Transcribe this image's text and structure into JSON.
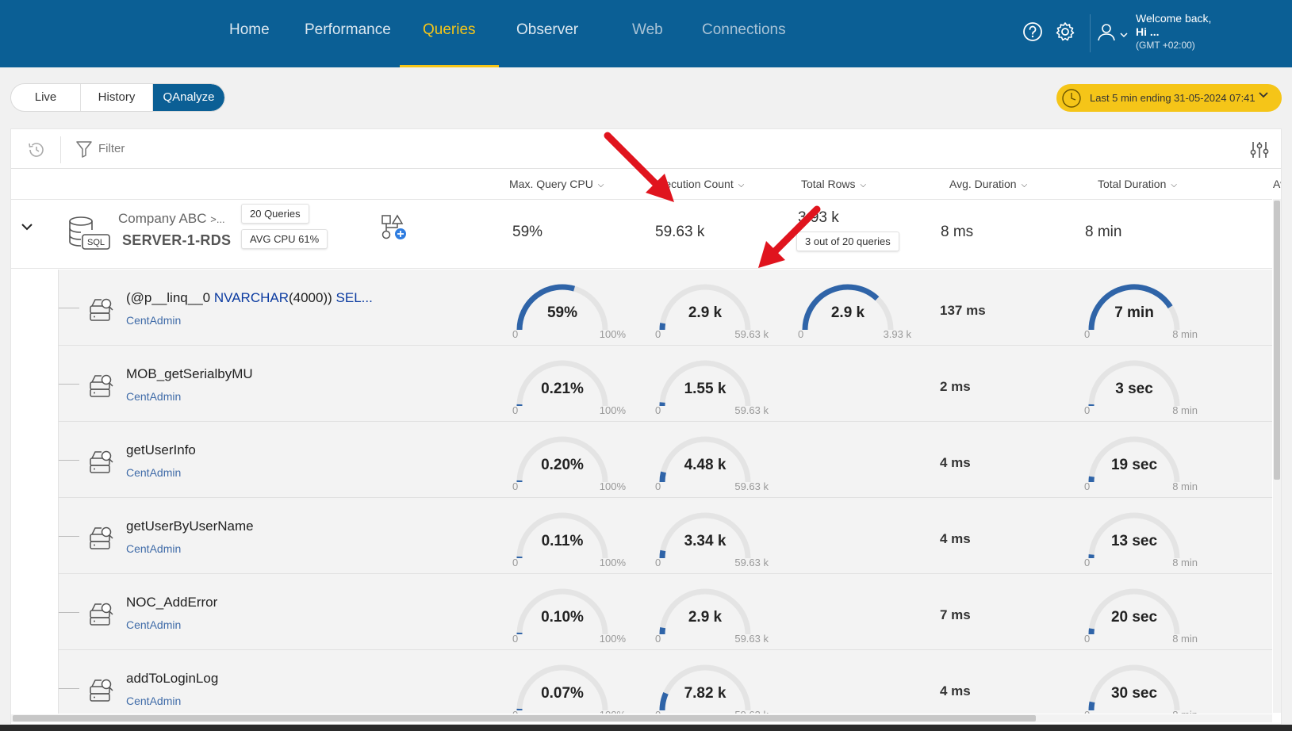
{
  "nav": {
    "items": [
      "Home",
      "Performance",
      "Queries",
      "Observer",
      "Web",
      "Connections"
    ],
    "active": "Queries"
  },
  "user": {
    "welcome": "Welcome back,",
    "name": "Hi  ...",
    "timezone": "(GMT +02:00)"
  },
  "tabs": [
    "Live",
    "History",
    "QAnalyze"
  ],
  "active_tab": "QAnalyze",
  "time_range": {
    "label": "Last 5 min ending",
    "datetime": "31-05-2024 07:41"
  },
  "toolbar": {
    "filter_placeholder": "Filter"
  },
  "columns": {
    "max_cpu": "Max. Query CPU",
    "exec_count": "Execution Count",
    "total_rows": "Total Rows",
    "avg_duration": "Avg. Duration",
    "total_duration": "Total Duration",
    "overflow": "Av"
  },
  "server": {
    "company": "Company ABC",
    "company_more": ">...",
    "name": "SERVER-1-RDS",
    "queries_chip": "20 Queries",
    "cpu_chip": "AVG CPU 61%",
    "db_label": "SQL",
    "max_cpu": "59%",
    "exec_count": "59.63 k",
    "total_rows": "3.93 k",
    "rows_chip": "3 out of 20 queries",
    "avg_duration": "8 ms",
    "total_duration": "8 min"
  },
  "gauge_labels": {
    "min": "0",
    "cpu_max": "100%",
    "exec_max": "59.63 k",
    "rows_max": "3.93 k",
    "dur_max": "8 min"
  },
  "queries": [
    {
      "name_parts": [
        "(@p__linq__0 ",
        "NVARCHAR",
        "(4000)) ",
        "SEL..."
      ],
      "db": "CentAdmin",
      "cpu": "59%",
      "cpu_frac": 0.59,
      "exec": "2.9 k",
      "exec_frac": 0.049,
      "rows": "2.9 k",
      "rows_frac": 0.74,
      "avg": "137 ms",
      "dur": "7 min",
      "dur_frac": 0.82
    },
    {
      "name": "MOB_getSerialbyMU",
      "db": "CentAdmin",
      "cpu": "0.21%",
      "cpu_frac": 0.0021,
      "exec": "1.55 k",
      "exec_frac": 0.026,
      "avg": "2 ms",
      "dur": "3 sec",
      "dur_frac": 0.006
    },
    {
      "name": "getUserInfo",
      "db": "CentAdmin",
      "cpu": "0.20%",
      "cpu_frac": 0.002,
      "exec": "4.48 k",
      "exec_frac": 0.075,
      "avg": "4 ms",
      "dur": "19 sec",
      "dur_frac": 0.04
    },
    {
      "name": "getUserByUserName",
      "db": "CentAdmin",
      "cpu": "0.11%",
      "cpu_frac": 0.0011,
      "exec": "3.34 k",
      "exec_frac": 0.056,
      "avg": "4 ms",
      "dur": "13 sec",
      "dur_frac": 0.027
    },
    {
      "name": "NOC_AddError",
      "db": "CentAdmin",
      "cpu": "0.10%",
      "cpu_frac": 0.001,
      "exec": "2.9 k",
      "exec_frac": 0.049,
      "avg": "7 ms",
      "dur": "20 sec",
      "dur_frac": 0.042
    },
    {
      "name": "addToLoginLog",
      "db": "CentAdmin",
      "cpu": "0.07%",
      "cpu_frac": 0.0007,
      "exec": "7.82 k",
      "exec_frac": 0.131,
      "avg": "4 ms",
      "dur": "30 sec",
      "dur_frac": 0.063
    }
  ],
  "colors": {
    "brand": "#0b5f95",
    "accent": "#f5c518",
    "gauge_fill": "#2f64a8",
    "gauge_track": "#e4e4e4",
    "annotation_arrow": "#e0141e"
  }
}
